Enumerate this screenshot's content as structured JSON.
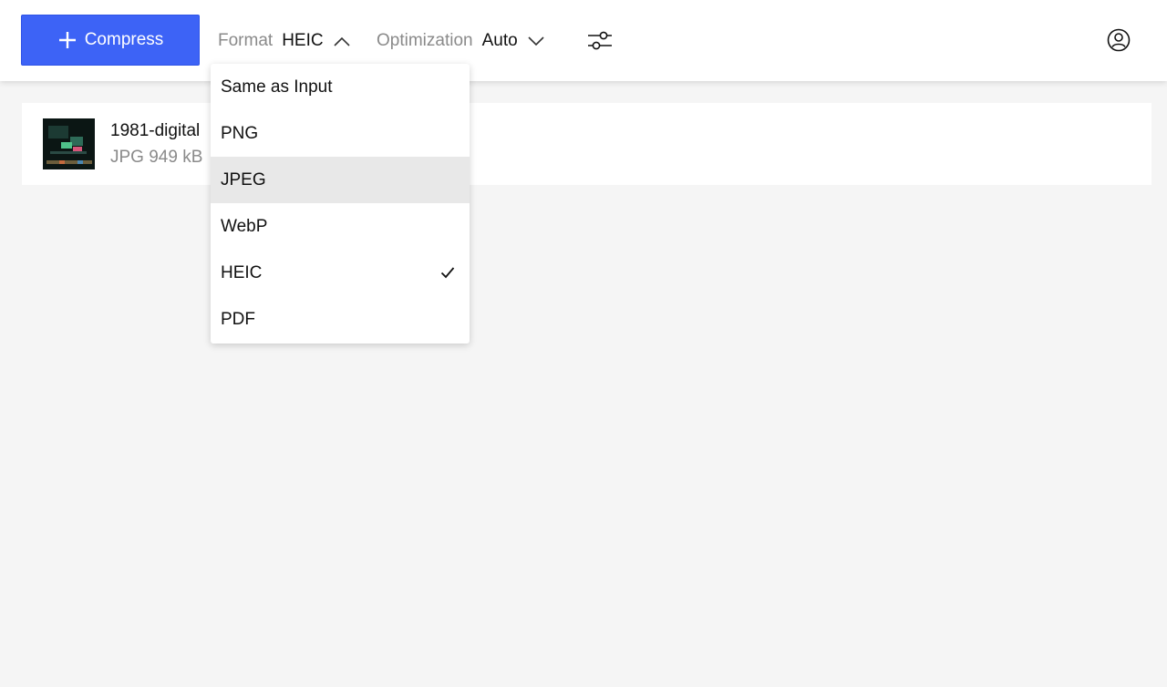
{
  "toolbar": {
    "compress_label": "Compress",
    "format": {
      "label": "Format",
      "value": "HEIC"
    },
    "optimization": {
      "label": "Optimization",
      "value": "Auto"
    }
  },
  "file": {
    "name": "1981-digital",
    "meta": "JPG 949 kB"
  },
  "format_menu": {
    "items": [
      {
        "label": "Same as Input"
      },
      {
        "label": "PNG"
      },
      {
        "label": "JPEG",
        "state": "hover"
      },
      {
        "label": "WebP"
      },
      {
        "label": "HEIC",
        "state": "selected"
      },
      {
        "label": "PDF"
      }
    ]
  },
  "colors": {
    "accent": "#3d63f6",
    "background": "#f5f5f5",
    "muted_text": "#8a8a8a",
    "hover": "#e8e8e8"
  },
  "icons": [
    "plus-icon",
    "chevron-up-icon",
    "chevron-down-icon",
    "sliders-icon",
    "account-icon",
    "checkmark-icon"
  ]
}
